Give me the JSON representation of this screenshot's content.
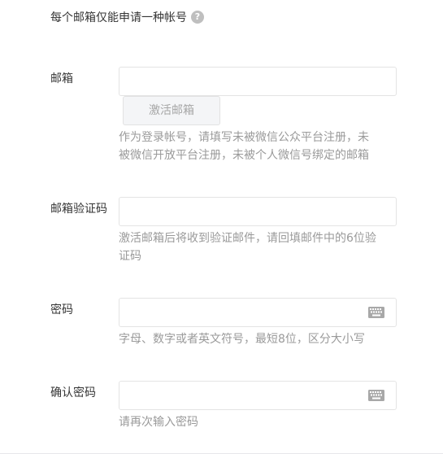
{
  "notice": {
    "text": "每个邮箱仅能申请一种帐号",
    "help_icon": "?"
  },
  "email": {
    "label": "邮箱",
    "value": "",
    "placeholder": "",
    "activate_button": "激活邮箱",
    "tip": "作为登录帐号，请填写未被微信公众平台注册，未被微信开放平台注册，未被个人微信号绑定的邮箱"
  },
  "verify_code": {
    "label": "邮箱验证码",
    "value": "",
    "placeholder": "",
    "tip": "激活邮箱后将收到验证邮件，请回填邮件中的6位验证码"
  },
  "password": {
    "label": "密码",
    "value": "",
    "placeholder": "",
    "tip": "字母、数字或者英文符号，最短8位，区分大小写",
    "keyboard_icon": "keyboard-icon"
  },
  "confirm_password": {
    "label": "确认密码",
    "value": "",
    "placeholder": "",
    "tip": "请再次输入密码",
    "keyboard_icon": "keyboard-icon"
  },
  "colors": {
    "text": "#353535",
    "tip": "#9a9a9a",
    "border": "#e4e4e4",
    "button_bg": "#f4f5f7",
    "button_text": "#a6a6a6",
    "help_icon_bg": "#bfbfbf"
  }
}
